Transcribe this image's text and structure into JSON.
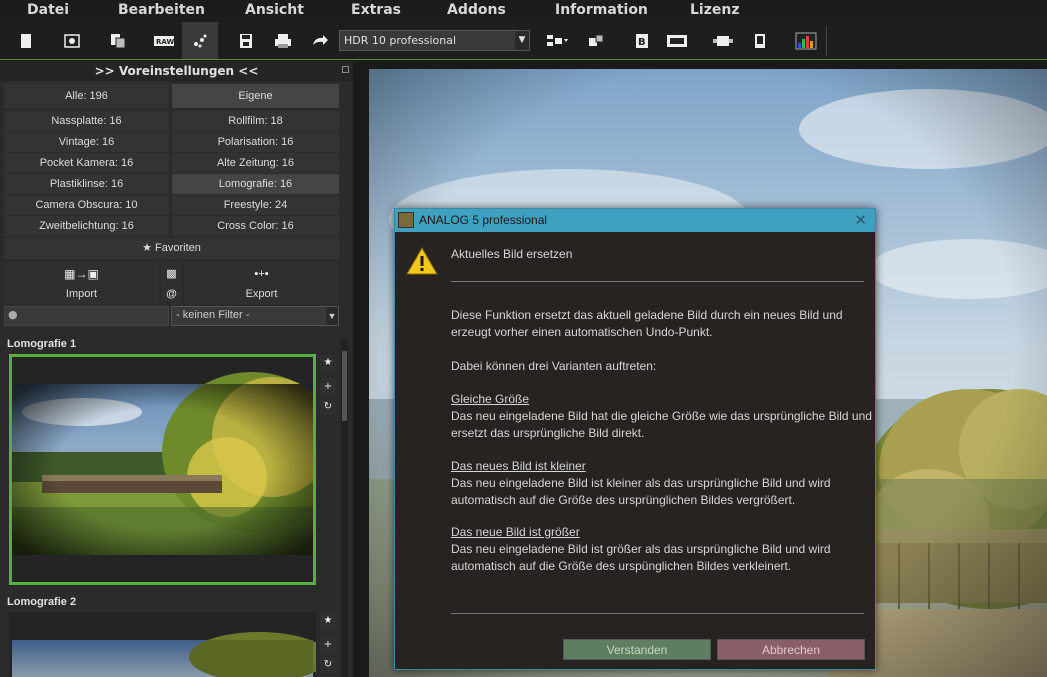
{
  "menu": [
    "Datei",
    "Bearbeiten",
    "Ansicht",
    "Extras",
    "Addons",
    "Information",
    "Lizenz"
  ],
  "toolbar": {
    "preset_value": "HDR 10 professional"
  },
  "left_panel": {
    "title": ">> Voreinstellungen <<",
    "all_label": "Alle: 196",
    "own_label": "Eigene",
    "categories": [
      "Nassplatte: 16",
      "Rollfilm: 18",
      "Vintage: 16",
      "Polarisation: 16",
      "Pocket Kamera: 16",
      "Alte Zeitung: 16",
      "Plastiklinse: 16",
      "Lomografie: 16",
      "Camera Obscura: 10",
      "Freestyle: 24",
      "Zweitbelichtung: 16",
      "Cross Color: 16"
    ],
    "favorites_label": "★ Favoriten",
    "import_label": "Import",
    "at_label": "@",
    "export_label": "Export",
    "filter_value": "- keinen Filter -",
    "thumbs": [
      {
        "title": "Lomografie 1"
      },
      {
        "title": "Lomografie 2"
      }
    ]
  },
  "dialog": {
    "title": "ANALOG 5 professional",
    "heading": "Aktuelles Bild ersetzen",
    "intro_1": "Diese Funktion ersetzt das aktuell geladene Bild durch ein neues Bild und",
    "intro_2": "erzeugt vorher einen automatischen Undo-Punkt.",
    "variants": "Dabei können drei Varianten auftreten:",
    "case1_title": "Gleiche Größe",
    "case1_1": "Das neu eingeladene Bild hat die gleiche Größe wie das ursprüngliche Bild und",
    "case1_2": "ersetzt das ursprüngliche Bild direkt.",
    "case2_title": "Das neues Bild ist kleiner",
    "case2_1": "Das neu eingeladene Bild ist kleiner als das ursprüngliche Bild und wird",
    "case2_2": "automatisch auf die Größe des ursprünglichen Bildes vergrößert.",
    "case3_title": "Das neue Bild ist größer",
    "case3_1": "Das neu eingeladene Bild ist größer als das ursprüngliche Bild und wird",
    "case3_2": "automatisch auf die Größe des urspünglichen Bildes verkleinert.",
    "ok_label": "Verstanden",
    "cancel_label": "Abbrechen"
  }
}
